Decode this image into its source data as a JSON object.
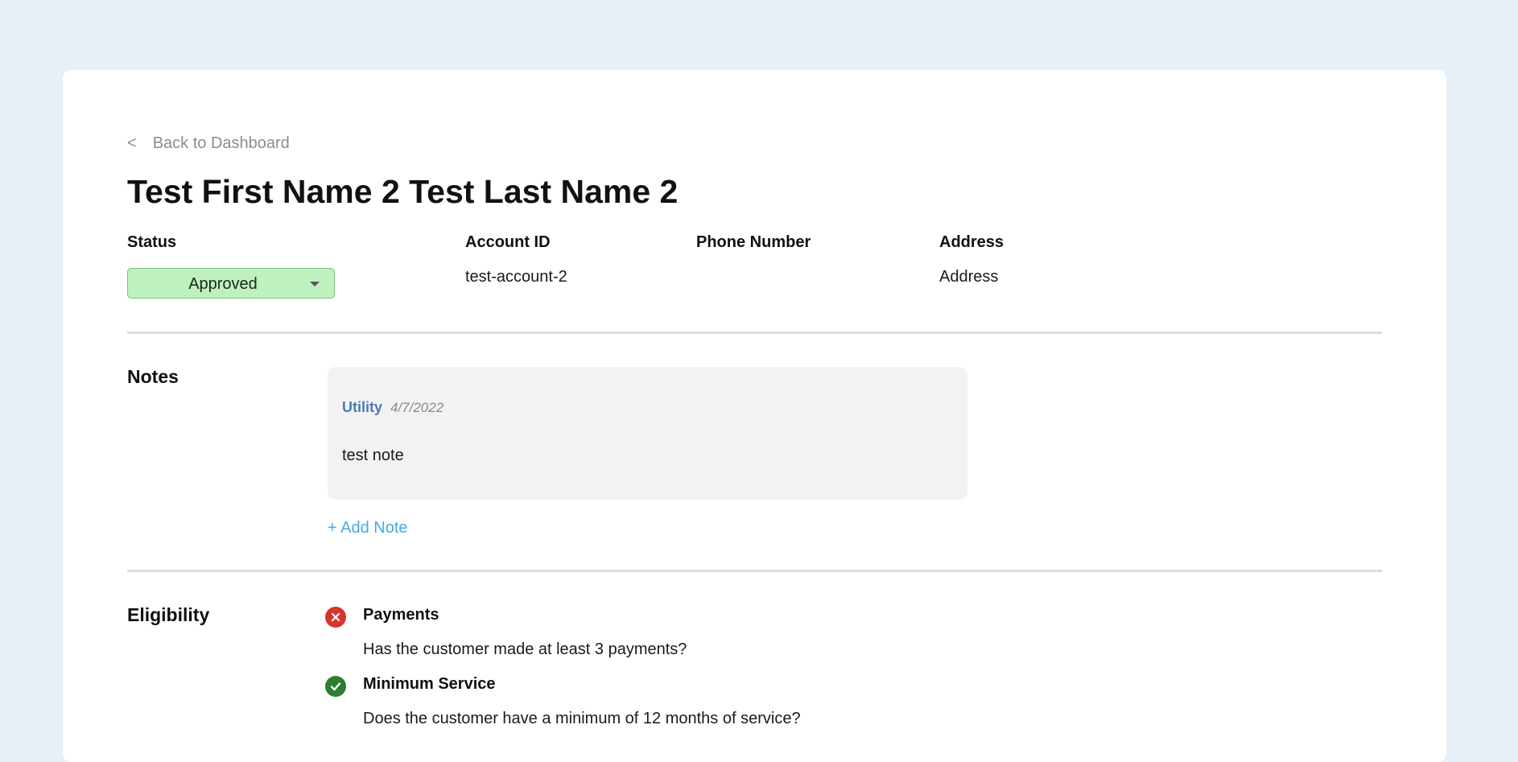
{
  "nav": {
    "back_chevron": "<",
    "back_label": "Back to Dashboard"
  },
  "customer": {
    "name": "Test First Name 2 Test Last Name 2"
  },
  "fields": {
    "status_label": "Status",
    "status_value": "Approved",
    "account_id_label": "Account ID",
    "account_id_value": "test-account-2",
    "phone_label": "Phone Number",
    "phone_value": "",
    "address_label": "Address",
    "address_value": "Address"
  },
  "notes": {
    "title": "Notes",
    "items": [
      {
        "category": "Utility",
        "date": "4/7/2022",
        "text": "test note"
      }
    ],
    "add_label": "+ Add Note"
  },
  "eligibility": {
    "title": "Eligibility",
    "items": [
      {
        "status": "fail",
        "icon": "x-circle-icon",
        "title": "Payments",
        "description": "Has the customer made at least 3 payments?"
      },
      {
        "status": "pass",
        "icon": "check-circle-icon",
        "title": "Minimum Service",
        "description": "Does the customer have a minimum of 12 months of service?"
      }
    ]
  },
  "colors": {
    "page_background": "#e8f0f8",
    "status_approved_bg": "#bdf2be",
    "note_category": "#4a7ab8",
    "add_note_link": "#4aabe0",
    "fail_icon": "#d9342b",
    "pass_icon": "#2e7d32"
  }
}
